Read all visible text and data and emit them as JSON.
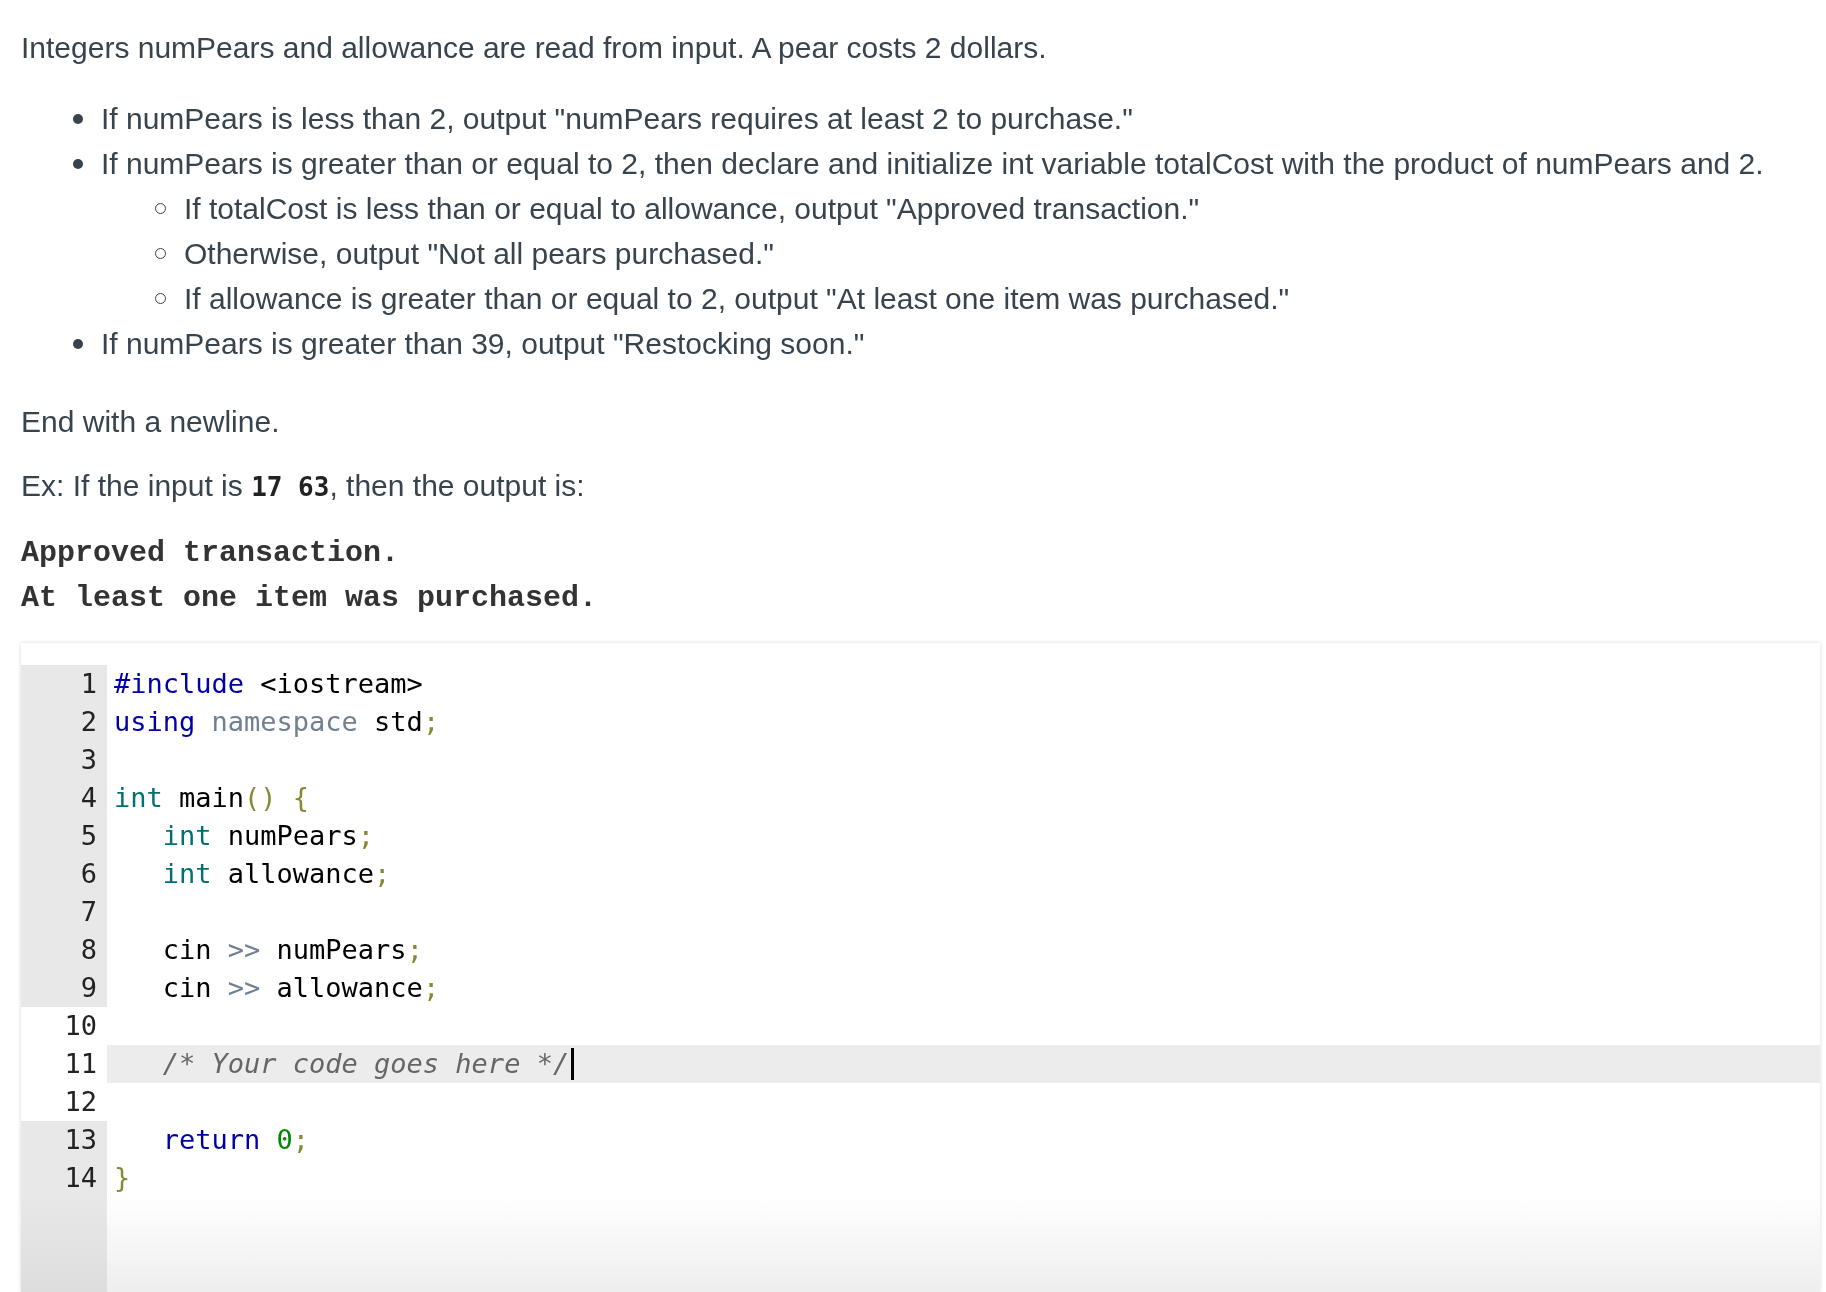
{
  "intro": "Integers numPears and allowance are read from input. A pear costs 2 dollars.",
  "bullets": [
    {
      "text": "If numPears is less than 2, output \"numPears requires at least 2 to purchase.\""
    },
    {
      "text": "If numPears is greater than or equal to 2, then declare and initialize int variable totalCost with the product of numPears and 2.",
      "children": [
        {
          "text": "If totalCost is less than or equal to allowance, output \"Approved transaction.\""
        },
        {
          "text": "Otherwise, output \"Not all pears purchased.\""
        },
        {
          "text": "If allowance is greater than or equal to 2, output \"At least one item was purchased.\""
        }
      ]
    },
    {
      "text": "If numPears is greater than 39, output \"Restocking soon.\""
    }
  ],
  "ending": "End with a newline.",
  "example": {
    "before": "Ex: If the input is ",
    "input": "17 63",
    "after": ", then the output is:"
  },
  "output_lines": [
    "Approved transaction.",
    "At least one item was purchased."
  ],
  "editor": {
    "lines": [
      {
        "number": "1",
        "readonly": true,
        "active": false,
        "tokens": [
          {
            "kind": "keyword",
            "text": "#include"
          },
          {
            "kind": "plain",
            "text": " <iostream>"
          }
        ]
      },
      {
        "number": "2",
        "readonly": true,
        "active": false,
        "tokens": [
          {
            "kind": "keyword",
            "text": "using"
          },
          {
            "kind": "def",
            "text": " namespace"
          },
          {
            "kind": "plain",
            "text": " std"
          },
          {
            "kind": "punct",
            "text": ";"
          }
        ]
      },
      {
        "number": "3",
        "readonly": true,
        "active": false
      },
      {
        "number": "4",
        "readonly": true,
        "active": false,
        "tokens": [
          {
            "kind": "type",
            "text": "int"
          },
          {
            "kind": "plain",
            "text": " main"
          },
          {
            "kind": "punct",
            "text": "() {"
          }
        ]
      },
      {
        "number": "5",
        "readonly": true,
        "active": false,
        "tokens": [
          {
            "kind": "type",
            "text": "   int"
          },
          {
            "kind": "plain",
            "text": " numPears"
          },
          {
            "kind": "punct",
            "text": ";"
          }
        ]
      },
      {
        "number": "6",
        "readonly": true,
        "active": false,
        "tokens": [
          {
            "kind": "type",
            "text": "   int"
          },
          {
            "kind": "plain",
            "text": " allowance"
          },
          {
            "kind": "punct",
            "text": ";"
          }
        ]
      },
      {
        "number": "7",
        "readonly": true,
        "active": false
      },
      {
        "number": "8",
        "readonly": true,
        "active": false,
        "tokens": [
          {
            "kind": "plain",
            "text": "   cin "
          },
          {
            "kind": "operator",
            "text": ">>"
          },
          {
            "kind": "plain",
            "text": " numPears"
          },
          {
            "kind": "punct",
            "text": ";"
          }
        ]
      },
      {
        "number": "9",
        "readonly": true,
        "active": false,
        "tokens": [
          {
            "kind": "plain",
            "text": "   cin "
          },
          {
            "kind": "operator",
            "text": ">>"
          },
          {
            "kind": "plain",
            "text": " allowance"
          },
          {
            "kind": "punct",
            "text": ";"
          }
        ]
      },
      {
        "number": "10",
        "readonly": false,
        "active": false
      },
      {
        "number": "11",
        "readonly": false,
        "active": true,
        "tokens": [
          {
            "kind": "comment",
            "text": "   /* Your code goes here */"
          }
        ]
      },
      {
        "number": "12",
        "readonly": false,
        "active": false
      },
      {
        "number": "13",
        "readonly": true,
        "active": false,
        "tokens": [
          {
            "kind": "keyword",
            "text": "   return"
          },
          {
            "kind": "number",
            "text": " 0"
          },
          {
            "kind": "punct",
            "text": ";"
          }
        ]
      },
      {
        "number": "14",
        "readonly": true,
        "active": false,
        "tokens": [
          {
            "kind": "punct",
            "text": "}"
          }
        ]
      }
    ]
  }
}
